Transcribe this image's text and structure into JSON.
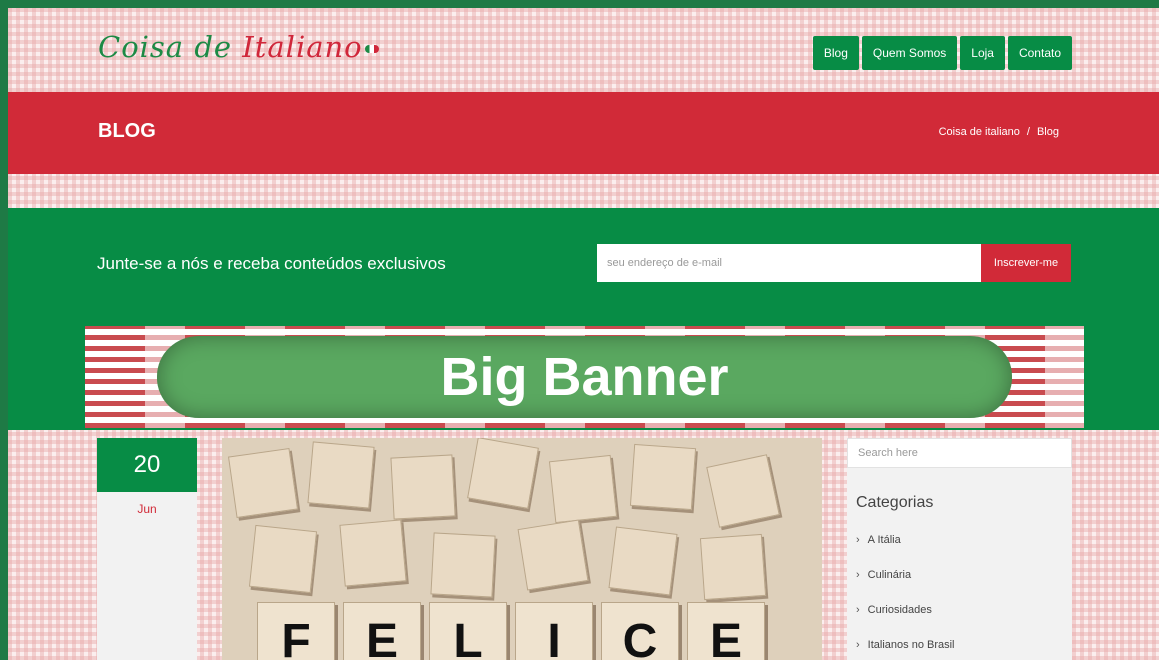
{
  "header": {
    "logo": {
      "part1": "Coisa de ",
      "part2": "Italiano"
    },
    "nav": [
      "Blog",
      "Quem Somos",
      "Loja",
      "Contato"
    ]
  },
  "page_title": "BLOG",
  "breadcrumb": {
    "home": "Coisa de italiano",
    "separator": "/",
    "current": "Blog"
  },
  "newsletter": {
    "text": "Junte-se a nós e receba conteúdos exclusivos",
    "email_placeholder": "seu endereço de e-mail",
    "subscribe_label": "Inscrever-me"
  },
  "banner": {
    "text": "Big Banner"
  },
  "post": {
    "day": "20",
    "month": "Jun",
    "image_letters": [
      "F",
      "E",
      "L",
      "I",
      "C",
      "E"
    ]
  },
  "sidebar": {
    "search_placeholder": "Search here",
    "categories_title": "Categorias",
    "categories": [
      "A Itália",
      "Culinária",
      "Curiosidades",
      "Italianos no Brasil"
    ]
  },
  "colors": {
    "green": "#078c45",
    "red": "#d12a38",
    "background_check": "#fbeeee"
  }
}
